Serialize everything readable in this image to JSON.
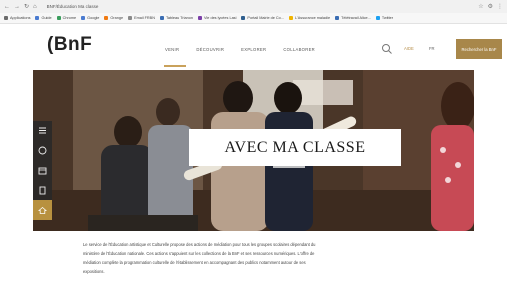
{
  "browser": {
    "address": "BNF/Éducation Ma classe",
    "bookmarks": [
      {
        "label": "Applications",
        "color": "#6b6b6b"
      },
      {
        "label": "Guide",
        "color": "#4a7bd0"
      },
      {
        "label": "Chrome",
        "color": "#3a9d5d"
      },
      {
        "label": "Google",
        "color": "#4a7bd0"
      },
      {
        "label": "Orange",
        "color": "#f07a12"
      },
      {
        "label": "Email FRBN",
        "color": "#8a8a8a"
      },
      {
        "label": "Tableau Trianon",
        "color": "#3a6db3"
      },
      {
        "label": "Vie des lycées Lasi",
        "color": "#7b3fa8"
      },
      {
        "label": "Portail Mairie de Co...",
        "color": "#2f5f8f"
      },
      {
        "label": "L'Assurance maladie",
        "color": "#f0b400"
      },
      {
        "label": "Télétravail Alice...",
        "color": "#3a6db3"
      },
      {
        "label": "Twitter",
        "color": "#1da1f2"
      }
    ]
  },
  "header": {
    "logo": "(BnF",
    "nav": [
      "VENIR",
      "DÉCOUVRIR",
      "EXPLORER",
      "COLLABORER"
    ],
    "login": "AIDE",
    "lang": "FR",
    "cta": "Rechercher la BnF"
  },
  "hero": {
    "title": "AVEC MA CLASSE"
  },
  "tools": [
    "menu-icon",
    "help-icon",
    "calendar-icon",
    "document-icon",
    "home-icon"
  ],
  "intro": [
    "Le service de l'Éducation artistique et Culturelle propose des actions de médiation pour tous les groupes scolaires dépendant du",
    "ministère de l'Éducation nationale. Ces actions s'appuient sur les collections de la BnF et ses ressources numériques. L'offre de",
    "médiation complète la programmation culturelle de l'établissement en accompagnant des publics notamment autour de ses",
    "expositions."
  ]
}
